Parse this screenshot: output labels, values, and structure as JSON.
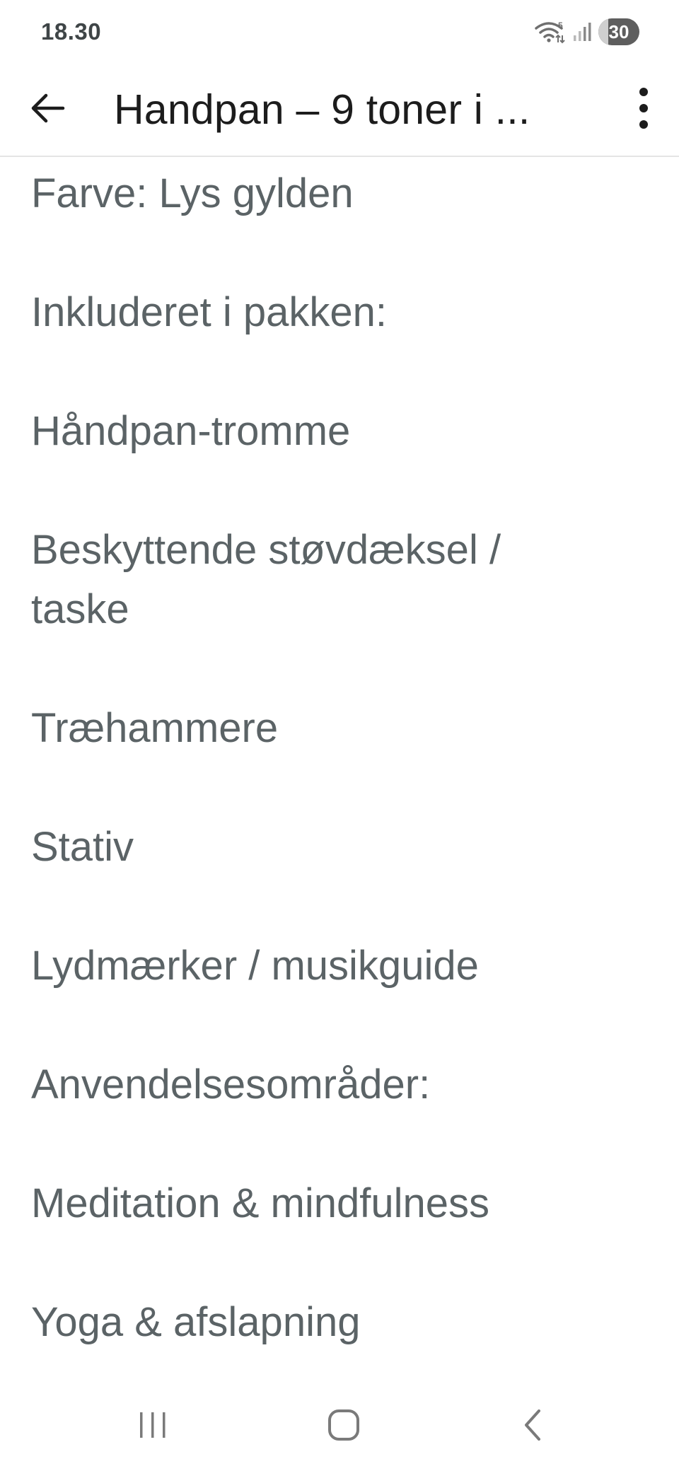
{
  "status_bar": {
    "time": "18.30",
    "battery": "30",
    "wifi_badge": "5"
  },
  "app_bar": {
    "title": "Handpan – 9 toner i ..."
  },
  "content": {
    "lines": [
      "Farve: Lys gylden",
      "Inkluderet i pakken:",
      "Håndpan-tromme",
      "Beskyttende støvdæksel /",
      "taske",
      "Træhammere",
      "Stativ",
      "Lydmærker / musikguide",
      "Anvendelsesområder:",
      "Meditation & mindfulness",
      "Yoga & afslapning"
    ]
  },
  "icons": {
    "back": "arrow-back-icon",
    "more": "more-vertical-icon",
    "nav_recents": "recents-icon",
    "nav_home": "home-icon",
    "nav_back": "chevron-left-icon"
  },
  "colors": {
    "text_primary": "#1c1c1c",
    "text_body": "#5b6366",
    "divider": "#e4e4e4",
    "icon_gray": "#6f6f6f"
  }
}
